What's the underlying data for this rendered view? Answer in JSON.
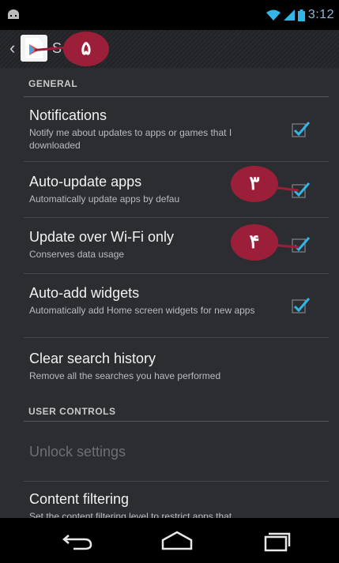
{
  "status_bar": {
    "time": "3:12",
    "left_icon": "android-icon",
    "icons": [
      "wifi-icon",
      "signal-icon",
      "battery-icon"
    ]
  },
  "action_bar": {
    "back_glyph": "‹",
    "app_icon": "play-store-icon",
    "title": "S"
  },
  "sections": {
    "general": {
      "header": "GENERAL",
      "items": [
        {
          "title": "Notifications",
          "subtitle": "Notify me about updates to apps or games that I downloaded",
          "checked": true
        },
        {
          "title": "Auto-update apps",
          "subtitle": "Automatically update apps by defau",
          "checked": true
        },
        {
          "title": "Update over Wi-Fi only",
          "subtitle": "Conserves data usage",
          "checked": true
        },
        {
          "title": "Auto-add widgets",
          "subtitle": "Automatically add Home screen widgets for new apps",
          "checked": true
        },
        {
          "title": "Clear search history",
          "subtitle": "Remove all the searches you have performed"
        }
      ]
    },
    "user_controls": {
      "header": "USER CONTROLS",
      "items": [
        {
          "title": "Unlock settings",
          "disabled": true
        },
        {
          "title": "Content filtering",
          "subtitle": "Set the content filtering level to restrict apps that"
        }
      ]
    }
  },
  "annotations": {
    "marker_5": "۵",
    "marker_3": "۳",
    "marker_4": "۴"
  },
  "colors": {
    "accent_check": "#33b5e5",
    "marker": "#9c1f3a"
  },
  "nav_bar": {
    "icons": [
      "back-icon",
      "home-icon",
      "recents-icon"
    ]
  }
}
